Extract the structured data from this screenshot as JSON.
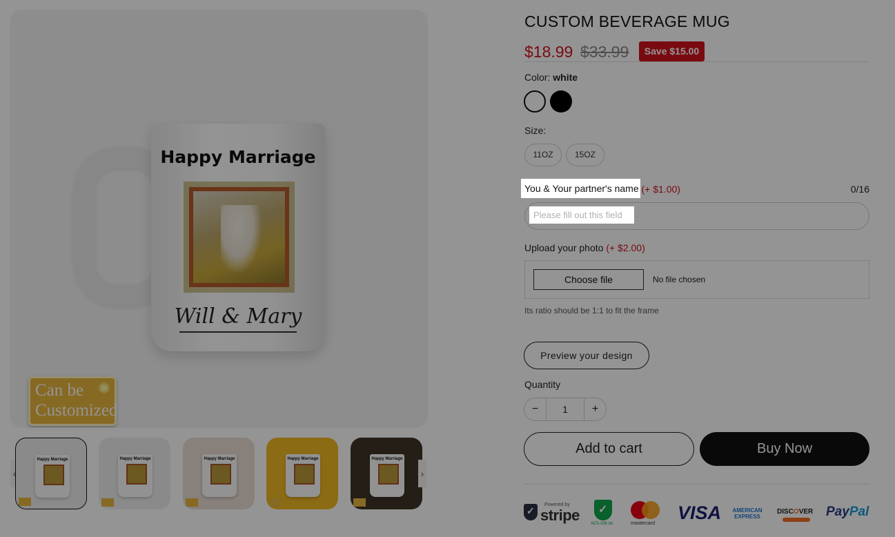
{
  "gallery": {
    "mug_title": "Happy Marriage",
    "mug_names": "Will & Mary",
    "badge_line1": "Can be",
    "badge_line2": "Customized",
    "thumbs": [
      {
        "mini_text": "Happy Marriage"
      },
      {
        "mini_text": "Happy Marriage"
      },
      {
        "mini_text": "Happy Marriage"
      },
      {
        "mini_text": "Happy Marriage"
      },
      {
        "mini_text": "Happy Marriage"
      }
    ],
    "prev_arrow": "‹",
    "next_arrow": "›"
  },
  "product": {
    "title": "CUSTOM BEVERAGE MUG",
    "price": "$18.99",
    "compare_price": "$33.99",
    "save_badge": "Save $15.00"
  },
  "color": {
    "label": "Color:",
    "selected": "white",
    "swatches": [
      "white",
      "black"
    ]
  },
  "size": {
    "label": "Size:",
    "options": [
      "11OZ",
      "15OZ"
    ]
  },
  "name_field": {
    "label": "You & Your partner's name",
    "extra_price": "(+ $1.00)",
    "counter": "0/16",
    "placeholder": "Please fill out this field",
    "value": ""
  },
  "upload": {
    "label": "Upload your photo",
    "extra_price": "(+ $2.00)",
    "button": "Choose file",
    "status": "No file chosen",
    "hint": "Its ratio should be 1:1 to fit the frame"
  },
  "preview_button": "Preview your design",
  "quantity": {
    "label": "Quantity",
    "value": "1",
    "minus": "−",
    "plus": "+"
  },
  "actions": {
    "add_to_cart": "Add to cart",
    "buy_now": "Buy Now"
  },
  "payments": {
    "stripe_powered": "Powered by",
    "stripe": "stripe",
    "aes": "AES-256 bit",
    "mastercard": "mastercard",
    "visa": "VISA",
    "amex_line1": "AMERICAN",
    "amex_line2": "EXPRESS",
    "discover_a": "DISC",
    "discover_o": "O",
    "discover_b": "VER",
    "paypal_a": "Pay",
    "paypal_b": "Pal"
  },
  "colors": {
    "accent_red": "#d0141d",
    "buy_now_bg": "#111111",
    "overlay": "rgba(0,0,0,0.42)"
  }
}
